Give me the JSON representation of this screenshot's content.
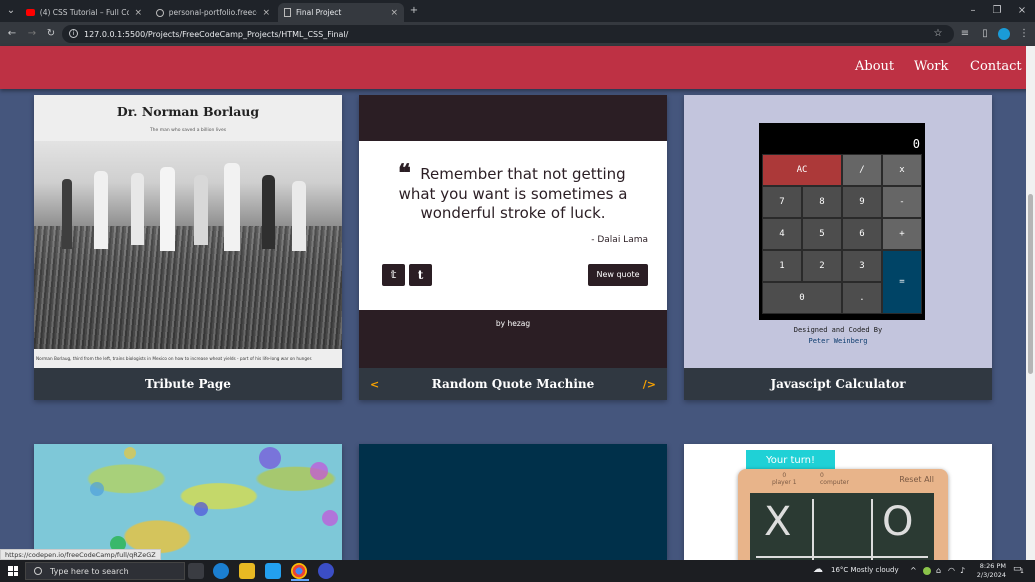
{
  "browser": {
    "tabs": [
      {
        "title": "(4) CSS Tutorial – Full Course fo",
        "active": false
      },
      {
        "title": "personal-portfolio.freecodecam",
        "active": false
      },
      {
        "title": "Final Project",
        "active": true
      }
    ],
    "url": "127.0.0.1:5500/Projects/FreeCodeCamp_Projects/HTML_CSS_Final/",
    "status_url": "https://codepen.io/freeCodeCamp/full/qRZeGZ"
  },
  "nav": {
    "links": [
      "About",
      "Work",
      "Contact"
    ]
  },
  "projects": [
    {
      "label": "Tribute Page",
      "title": "Dr. Norman Borlaug",
      "subtitle": "The man who saved a billion lives",
      "caption": "Norman Borlaug, third from the left, trains biologists in Mexico on how to increase wheat yields - part of his life-long war on hunger."
    },
    {
      "label": "Random Quote Machine",
      "quote": "Remember that not getting what you want is sometimes a wonderful stroke of luck.",
      "author": "- Dalai Lama",
      "new_quote": "New quote",
      "by": "by",
      "by_name": "hezag",
      "prev": "<",
      "next": "/>"
    },
    {
      "label": "Javascipt Calculator",
      "display": "0",
      "keys": [
        "AC",
        "/",
        "x",
        "7",
        "8",
        "9",
        "-",
        "4",
        "5",
        "6",
        "+",
        "1",
        "2",
        "3",
        "=",
        "0",
        "."
      ],
      "credit_line1": "Designed and Coded By",
      "credit_line2": "Peter Weinberg"
    }
  ],
  "tictactoe": {
    "your_turn": "Your turn!",
    "reset": "Reset All",
    "player": "player 1",
    "computer": "computer",
    "zero": "0",
    "x_mark": "X",
    "o_mark": "O"
  },
  "taskbar": {
    "search": "Type here to search",
    "weather": "16°C  Mostly cloudy",
    "time": "8:26 PM",
    "date": "2/3/2024",
    "notifications": "1"
  },
  "colors": {
    "nav": "#be3144",
    "bg": "#45567d",
    "card": "#303841",
    "quote_bg": "#2b1e24",
    "calc_bg": "#c3c5dd",
    "accent_orange": "#f8a200"
  }
}
